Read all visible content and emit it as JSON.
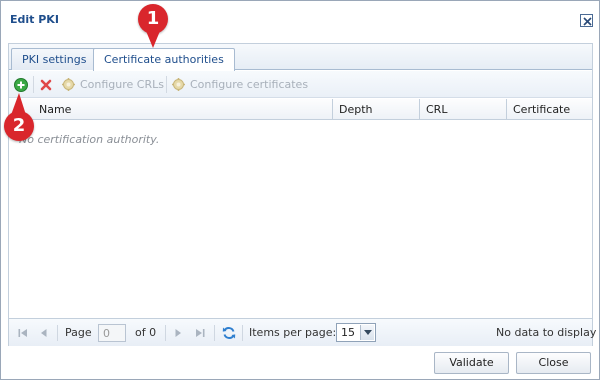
{
  "dialog": {
    "title": "Edit PKI"
  },
  "tabs": [
    {
      "label": "PKI settings",
      "active": false
    },
    {
      "label": "Certificate authorities",
      "active": true
    }
  ],
  "toolbar": {
    "add_icon": "add-green-plus-icon",
    "delete_icon": "delete-red-x-icon",
    "configure_crls_label": "Configure CRLs",
    "configure_certificates_label": "Configure certificates"
  },
  "grid": {
    "columns": [
      "Name",
      "Depth",
      "CRL",
      "Certificate"
    ],
    "empty_message": "No certification authority."
  },
  "pager": {
    "page_label": "Page",
    "page_value": "0",
    "of_label": "of 0",
    "items_per_page_label": "Items per page:",
    "items_per_page_value": "15",
    "status": "No data to display"
  },
  "footer": {
    "validate_label": "Validate",
    "close_label": "Close"
  },
  "callouts": [
    "1",
    "2"
  ],
  "colors": {
    "title": "#1f4e8c",
    "callout": "#d9262c",
    "add_icon": "#3aa845",
    "delete_icon": "#e04848"
  }
}
